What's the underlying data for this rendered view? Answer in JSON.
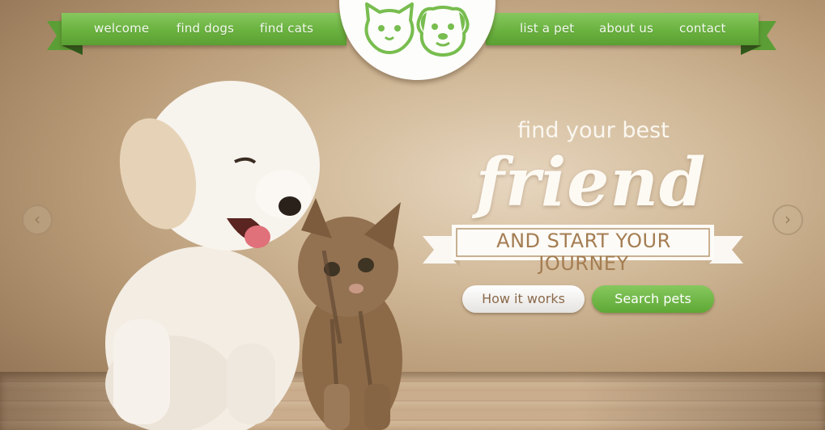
{
  "nav": {
    "left": [
      "welcome",
      "find dogs",
      "find cats"
    ],
    "right": [
      "list a pet",
      "about us",
      "contact"
    ]
  },
  "hero": {
    "line1": "find your best",
    "line2": "friend",
    "banner": "AND START YOUR JOURNEY",
    "button_how": "How it works",
    "button_search": "Search pets"
  },
  "slider": {
    "prev_symbol": "‹",
    "next_symbol": "›"
  },
  "colors": {
    "green": "#6ab23f",
    "banner_text": "#a47d52",
    "background": "#d3bc9c"
  },
  "icons": {
    "logo": "cat-and-dog-logo-icon",
    "prev": "chevron-left-icon",
    "next": "chevron-right-icon"
  }
}
